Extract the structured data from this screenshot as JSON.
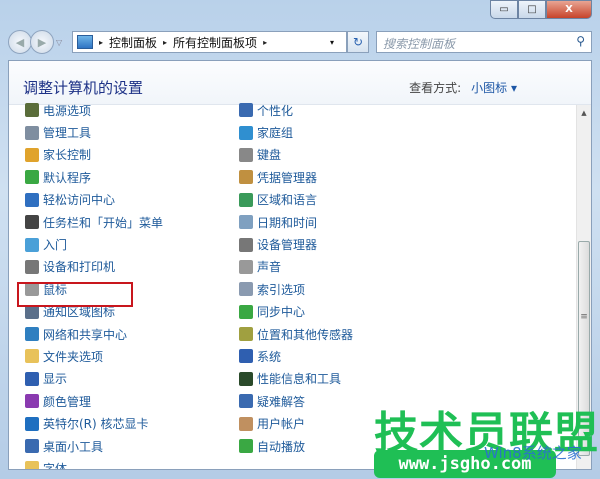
{
  "window": {
    "minimize": "▭",
    "maximize": "□",
    "close": "X"
  },
  "nav": {
    "back": "◀",
    "forward": "▶",
    "dropdown": "▽"
  },
  "address": {
    "crumbs": [
      "控制面板",
      "所有控制面板项"
    ],
    "sep": "▸",
    "dropdown": "▾"
  },
  "refresh": "↻",
  "search": {
    "placeholder": "搜索控制面板",
    "icon": "⚲"
  },
  "header": {
    "title": "调整计算机的设置",
    "view_label": "查看方式:",
    "view_value": "小图标 ▾"
  },
  "left_items": [
    {
      "label": "电源选项",
      "color": "#5a6d3a"
    },
    {
      "label": "管理工具",
      "color": "#7f8ea0"
    },
    {
      "label": "家长控制",
      "color": "#e0a32c"
    },
    {
      "label": "默认程序",
      "color": "#3aa843"
    },
    {
      "label": "轻松访问中心",
      "color": "#2f6fc0"
    },
    {
      "label": "任务栏和「开始」菜单",
      "color": "#444444"
    },
    {
      "label": "入门",
      "color": "#4aa0d8"
    },
    {
      "label": "设备和打印机",
      "color": "#777777"
    },
    {
      "label": "鼠标",
      "color": "#999999"
    },
    {
      "label": "通知区域图标",
      "color": "#5a6f8a"
    },
    {
      "label": "网络和共享中心",
      "color": "#2f7fc0"
    },
    {
      "label": "文件夹选项",
      "color": "#e8c25a"
    },
    {
      "label": "显示",
      "color": "#2f5fb0"
    },
    {
      "label": "颜色管理",
      "color": "#8a3ab0"
    },
    {
      "label": "英特尔(R) 核芯显卡",
      "color": "#1f6fc0"
    },
    {
      "label": "桌面小工具",
      "color": "#3a6ab0"
    },
    {
      "label": "字体",
      "color": "#e8c25a"
    }
  ],
  "right_items": [
    {
      "label": "个性化",
      "color": "#3a6ab0"
    },
    {
      "label": "家庭组",
      "color": "#2f8fd0"
    },
    {
      "label": "键盘",
      "color": "#888888"
    },
    {
      "label": "凭据管理器",
      "color": "#c09040"
    },
    {
      "label": "区域和语言",
      "color": "#3a9a5a"
    },
    {
      "label": "日期和时间",
      "color": "#7fa0c0"
    },
    {
      "label": "设备管理器",
      "color": "#777777"
    },
    {
      "label": "声音",
      "color": "#999999"
    },
    {
      "label": "索引选项",
      "color": "#8a9ab0"
    },
    {
      "label": "同步中心",
      "color": "#3aa843"
    },
    {
      "label": "位置和其他传感器",
      "color": "#a0a040"
    },
    {
      "label": "系统",
      "color": "#2f5fb0"
    },
    {
      "label": "性能信息和工具",
      "color": "#2a4a2a"
    },
    {
      "label": "疑难解答",
      "color": "#3a6ab0"
    },
    {
      "label": "用户帐户",
      "color": "#c09060"
    },
    {
      "label": "自动播放",
      "color": "#3aa843"
    }
  ],
  "scrollbar": {
    "up": "▲",
    "grip": "≡"
  },
  "watermark": {
    "brand": "技术员联盟",
    "url": "www.jsgho.com",
    "sub": "Win8系统之家"
  }
}
